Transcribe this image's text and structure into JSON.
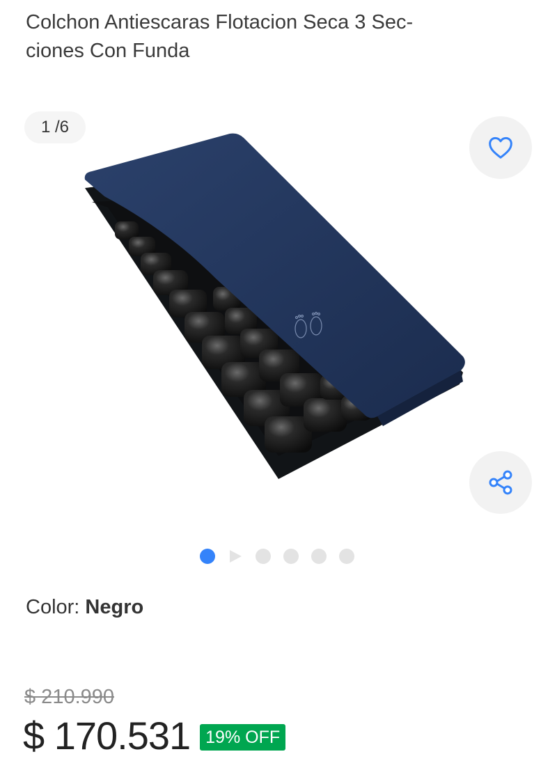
{
  "product": {
    "title_line1": "Colchon Antiescaras Flotacion Seca 3 Sec-",
    "title_line2": "ciones Con Funda"
  },
  "gallery": {
    "counter": "1 /6",
    "favorite_icon": "heart-icon",
    "share_icon": "share-icon",
    "image_subject": "mattress-image",
    "dots": {
      "active": 0,
      "video_index": 1,
      "total": 6
    }
  },
  "variant": {
    "color_label": "Color: ",
    "color_value": "Negro"
  },
  "pricing": {
    "original_price": "$ 210.990",
    "current_price": "$ 170.531",
    "discount_badge": "19% OFF"
  },
  "colors": {
    "accent": "#3483fa",
    "discount_green": "#00a650",
    "mattress_cover": "#1f3459"
  }
}
